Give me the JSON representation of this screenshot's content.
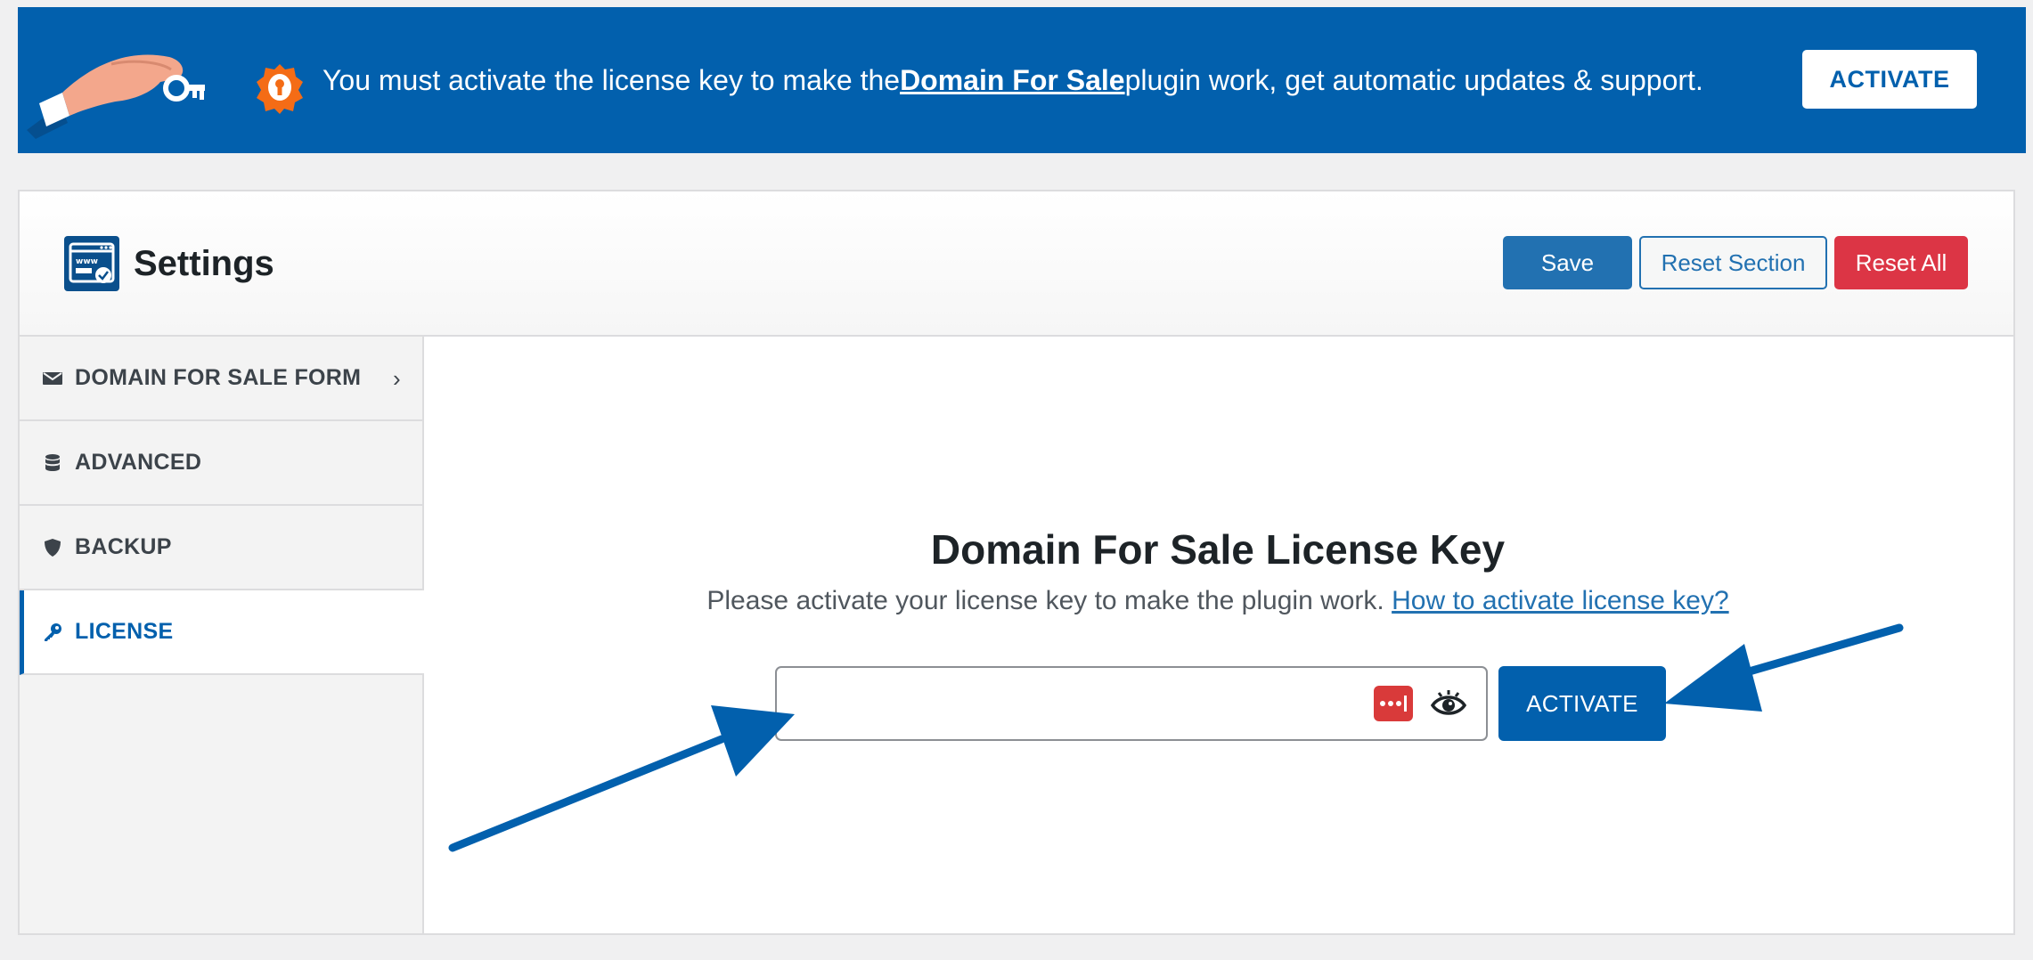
{
  "colors": {
    "brand_blue": "#0260ad",
    "button_blue": "#2271b1",
    "danger_red": "#dc3545",
    "badge_orange": "#f46c16",
    "password_manager_red": "#d93a3a"
  },
  "banner": {
    "text_before": "You must activate the license key to make the ",
    "plugin_name": "Domain For Sale",
    "text_after": " plugin work, get automatic updates & support.",
    "activate_label": "ACTIVATE",
    "icons": [
      "hand-with-key-icon",
      "keyhole-badge-icon"
    ]
  },
  "header": {
    "title": "Settings",
    "icon": "www-settings-icon",
    "buttons": {
      "save": "Save",
      "reset_section": "Reset Section",
      "reset_all": "Reset All"
    }
  },
  "sidebar": {
    "items": [
      {
        "label": "DOMAIN FOR SALE FORM",
        "icon": "envelope-icon",
        "has_chevron": true,
        "chevron": "›",
        "active": false
      },
      {
        "label": "ADVANCED",
        "icon": "database-icon",
        "has_chevron": false,
        "active": false
      },
      {
        "label": "BACKUP",
        "icon": "shield-icon",
        "has_chevron": false,
        "active": false
      },
      {
        "label": "LICENSE",
        "icon": "key-icon",
        "has_chevron": false,
        "active": true
      }
    ]
  },
  "license": {
    "title": "Domain For Sale License Key",
    "description": "Please activate your license key to make the plugin work.",
    "help_link": "How to activate license key?",
    "input_value": "",
    "input_icons": [
      "password-manager-icon",
      "eye-icon"
    ],
    "activate_label": "ACTIVATE"
  }
}
